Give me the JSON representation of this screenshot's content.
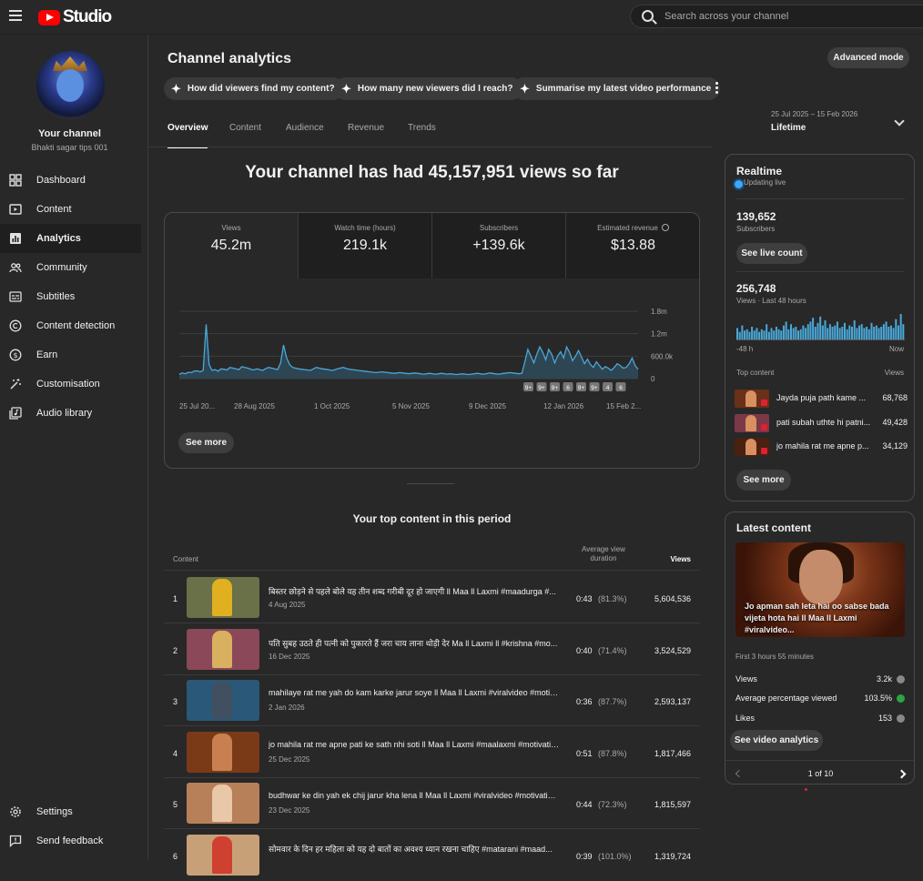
{
  "app": {
    "logo_text": "Studio",
    "search_placeholder": "Search across your channel"
  },
  "channel": {
    "name": "Your channel",
    "subtitle": "Bhakti sagar tips 001"
  },
  "sidebar": {
    "items": [
      {
        "label": "Dashboard",
        "icon": "dashboard-icon"
      },
      {
        "label": "Content",
        "icon": "content-icon"
      },
      {
        "label": "Analytics",
        "icon": "analytics-icon",
        "active": true
      },
      {
        "label": "Community",
        "icon": "community-icon"
      },
      {
        "label": "Subtitles",
        "icon": "subtitles-icon"
      },
      {
        "label": "Content detection",
        "icon": "copyright-icon"
      },
      {
        "label": "Earn",
        "icon": "dollar-icon"
      },
      {
        "label": "Customisation",
        "icon": "magic-wand-icon"
      },
      {
        "label": "Audio library",
        "icon": "audio-library-icon"
      }
    ],
    "bottom": [
      {
        "label": "Settings",
        "icon": "gear-icon"
      },
      {
        "label": "Send feedback",
        "icon": "feedback-icon"
      }
    ]
  },
  "page": {
    "title": "Channel analytics",
    "advanced_mode": "Advanced mode",
    "chips": [
      "How did viewers find my content?",
      "How many new viewers did I reach?",
      "Summarise my latest video performance"
    ],
    "tabs": [
      "Overview",
      "Content",
      "Audience",
      "Revenue",
      "Trends"
    ],
    "active_tab": "Overview",
    "date_range": "25 Jul 2025 – 15 Feb 2026",
    "period": "Lifetime",
    "headline": "Your channel has had 45,157,951 views so far"
  },
  "metrics": [
    {
      "label": "Views",
      "value": "45.2m"
    },
    {
      "label": "Watch time (hours)",
      "value": "219.1k"
    },
    {
      "label": "Subscribers",
      "value": "+139.6k"
    },
    {
      "label": "Estimated revenue",
      "value": "$13.88"
    }
  ],
  "chart_data": {
    "type": "area",
    "series": [
      {
        "values": [
          120000,
          150000,
          130000,
          170000,
          160000,
          200000,
          210000,
          180000,
          220000,
          1450000,
          380000,
          220000,
          240000,
          200000,
          260000,
          250000,
          230000,
          300000,
          280000,
          260000,
          240000,
          320000,
          300000,
          280000,
          250000,
          230000,
          260000,
          240000,
          220000,
          270000,
          300000,
          280000,
          260000,
          240000,
          420000,
          900000,
          560000,
          380000,
          300000,
          280000,
          260000,
          250000,
          240000,
          230000,
          220000,
          260000,
          300000,
          280000,
          260000,
          250000,
          240000,
          220000,
          230000,
          260000,
          280000,
          300000,
          270000,
          250000,
          240000,
          230000,
          220000,
          210000,
          200000,
          190000,
          180000,
          170000,
          160000,
          170000,
          180000,
          170000,
          160000,
          150000,
          140000,
          150000,
          160000,
          150000,
          140000,
          130000,
          140000,
          150000,
          140000,
          130000,
          120000,
          130000,
          140000,
          130000,
          120000,
          130000,
          140000,
          130000,
          120000,
          130000,
          120000,
          110000,
          120000,
          130000,
          120000,
          110000,
          120000,
          130000,
          140000,
          130000,
          120000,
          130000,
          150000,
          140000,
          130000,
          120000,
          130000,
          140000,
          150000,
          160000,
          150000,
          140000,
          130000,
          140000,
          450000,
          780000,
          600000,
          420000,
          650000,
          850000,
          700000,
          500000,
          780000,
          650000,
          420000,
          600000,
          720000,
          550000,
          850000,
          700000,
          480000,
          600000,
          750000,
          580000,
          400000,
          520000,
          380000,
          300000,
          450000,
          350000,
          250000,
          320000,
          280000,
          220000,
          300000,
          400000,
          350000,
          280000,
          300000,
          400000,
          550000,
          350000,
          250000
        ]
      }
    ],
    "x_tick_labels": [
      "25 Jul 20...",
      "28 Aug 2025",
      "1 Oct 2025",
      "5 Nov 2025",
      "9 Dec 2025",
      "12 Jan 2026",
      "15 Feb 2..."
    ],
    "y_tick_labels": [
      "1.8m",
      "1.2m",
      "600.0k",
      "0"
    ],
    "ylim": [
      0,
      1800000
    ],
    "grid": true,
    "markers": [
      "9+",
      "9+",
      "9+",
      "6",
      "9+",
      "9+",
      "4",
      "6"
    ]
  },
  "chart_card": {
    "see_more": "See more"
  },
  "top_content": {
    "title": "Your top content in this period",
    "headers": {
      "content": "Content",
      "avg": "Average view duration",
      "views": "Views"
    },
    "rows": [
      {
        "n": "1",
        "title": "बिस्तर छोड़ने से पहले बोले यह तीन शब्द गरीबी दूर हो जाएगी ll Maa ll Laxmi #maadurga #...",
        "date": "4 Aug 2025",
        "dur": "0:43",
        "pct": "(81.3%)",
        "views": "5,604,536",
        "bg": "#6a7048",
        "fg": "#e0b020"
      },
      {
        "n": "2",
        "title": "पति सुबह उठते ही पत्नी को पुकारते हैं जरा चाय लाना थोड़ी देर Ma ll Laxmi ll #krishna #mo...",
        "date": "16 Dec 2025",
        "dur": "0:40",
        "pct": "(71.4%)",
        "views": "3,524,529",
        "bg": "#8a4858",
        "fg": "#d8b060"
      },
      {
        "n": "3",
        "title": "mahilaye rat me yah do kam karke jarur soye ll Maa ll Laxmi #viralvideo #motivati...",
        "date": "2 Jan 2026",
        "dur": "0:36",
        "pct": "(87.7%)",
        "views": "2,593,137",
        "bg": "#2a5878",
        "fg": "#405060"
      },
      {
        "n": "4",
        "title": "jo mahila rat me apne pati ke sath nhi soti ll Maa ll Laxmi #maalaxmi #motivatio...",
        "date": "25 Dec 2025",
        "dur": "0:51",
        "pct": "(87.8%)",
        "views": "1,817,466",
        "bg": "#7a3a18",
        "fg": "#c88050"
      },
      {
        "n": "5",
        "title": "budhwar ke din yah ek chij jarur kha lena ll Maa ll Laxmi #viralvideo #motivation ...",
        "date": "23 Dec 2025",
        "dur": "0:44",
        "pct": "(72.3%)",
        "views": "1,815,597",
        "bg": "#b88058",
        "fg": "#e8c8a8"
      },
      {
        "n": "6",
        "title": "सोमवार के दिन हर महिला को यह दो बातों का अवश्य ध्यान रखना चाहिए #matarani #maad...",
        "date": "",
        "dur": "0:39",
        "pct": "(101.0%)",
        "views": "1,319,724",
        "bg": "#c8a078",
        "fg": "#d04030"
      }
    ]
  },
  "realtime": {
    "title": "Realtime",
    "status": "Updating live",
    "subs": "139,652",
    "subs_label": "Subscribers",
    "see_live": "See live count",
    "views": "256,748",
    "views_label": "Views · Last 48 hours",
    "bars": [
      0.45,
      0.3,
      0.55,
      0.35,
      0.4,
      0.3,
      0.5,
      0.35,
      0.45,
      0.3,
      0.4,
      0.35,
      0.6,
      0.3,
      0.45,
      0.35,
      0.5,
      0.4,
      0.35,
      0.55,
      0.7,
      0.4,
      0.6,
      0.45,
      0.5,
      0.35,
      0.4,
      0.55,
      0.45,
      0.6,
      0.7,
      0.85,
      0.5,
      0.65,
      0.9,
      0.55,
      0.75,
      0.45,
      0.6,
      0.5,
      0.55,
      0.7,
      0.45,
      0.5,
      0.65,
      0.4,
      0.55,
      0.5,
      0.75,
      0.45,
      0.55,
      0.6,
      0.45,
      0.5,
      0.4,
      0.65,
      0.5,
      0.55,
      0.45,
      0.5,
      0.6,
      0.7,
      0.5,
      0.55,
      0.45,
      0.8,
      0.55,
      1.0,
      0.6
    ],
    "axis_left": "-48 h",
    "axis_right": "Now",
    "top_label": "Top content",
    "top_views_label": "Views",
    "top": [
      {
        "name": "Jayda puja path kame ...",
        "views": "68,768"
      },
      {
        "name": "pati subah uthte hi patni...",
        "views": "49,428"
      },
      {
        "name": "jo mahila rat me apne p...",
        "views": "34,129"
      }
    ],
    "see_more": "See more"
  },
  "latest": {
    "title": "Latest content",
    "caption": "Jo apman sah leta hai oo sabse bada vijeta hota hai ll Maa ll Laxmi #viralvideo...",
    "since": "First 3 hours 55 minutes",
    "stats": [
      {
        "label": "Views",
        "value": "3.2k",
        "trend": "down"
      },
      {
        "label": "Average percentage viewed",
        "value": "103.5%",
        "trend": "up"
      },
      {
        "label": "Likes",
        "value": "153",
        "trend": "down"
      }
    ],
    "button": "See video analytics",
    "pager": "1 of 10"
  }
}
